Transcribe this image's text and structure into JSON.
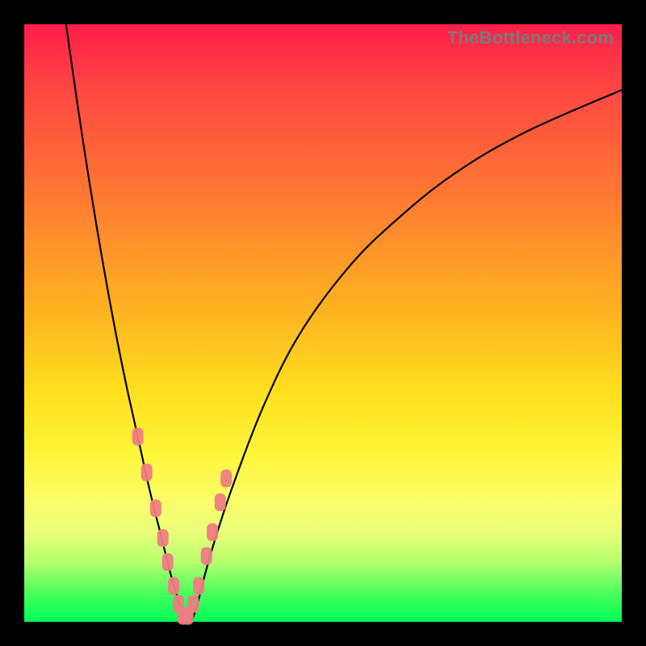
{
  "watermark": "TheBottleneck.com",
  "chart_data": {
    "type": "line",
    "title": "",
    "xlabel": "",
    "ylabel": "",
    "xlim": [
      0,
      100
    ],
    "ylim": [
      0,
      100
    ],
    "grid": false,
    "series": [
      {
        "name": "left-curve",
        "x": [
          7,
          9,
          11,
          13,
          15,
          17,
          19,
          21,
          23,
          24.5,
          26,
          27
        ],
        "y": [
          100,
          86,
          73,
          61,
          50,
          40,
          31,
          22,
          14,
          8,
          3,
          0
        ]
      },
      {
        "name": "right-curve",
        "x": [
          28,
          29,
          30,
          32,
          35,
          40,
          46,
          54,
          62,
          72,
          84,
          100
        ],
        "y": [
          0,
          3,
          7,
          14,
          23,
          36,
          48,
          59,
          67,
          75,
          82,
          89
        ]
      }
    ],
    "points": {
      "name": "highlighted-points",
      "x": [
        19,
        20.5,
        22,
        23.2,
        24,
        25,
        25.8,
        26.6,
        27.4,
        28.3,
        29.2,
        30.5,
        31.5,
        32.8,
        33.8
      ],
      "y": [
        31,
        25,
        19,
        14,
        10,
        6,
        3,
        1,
        1,
        3,
        6,
        11,
        15,
        20,
        24
      ]
    }
  }
}
